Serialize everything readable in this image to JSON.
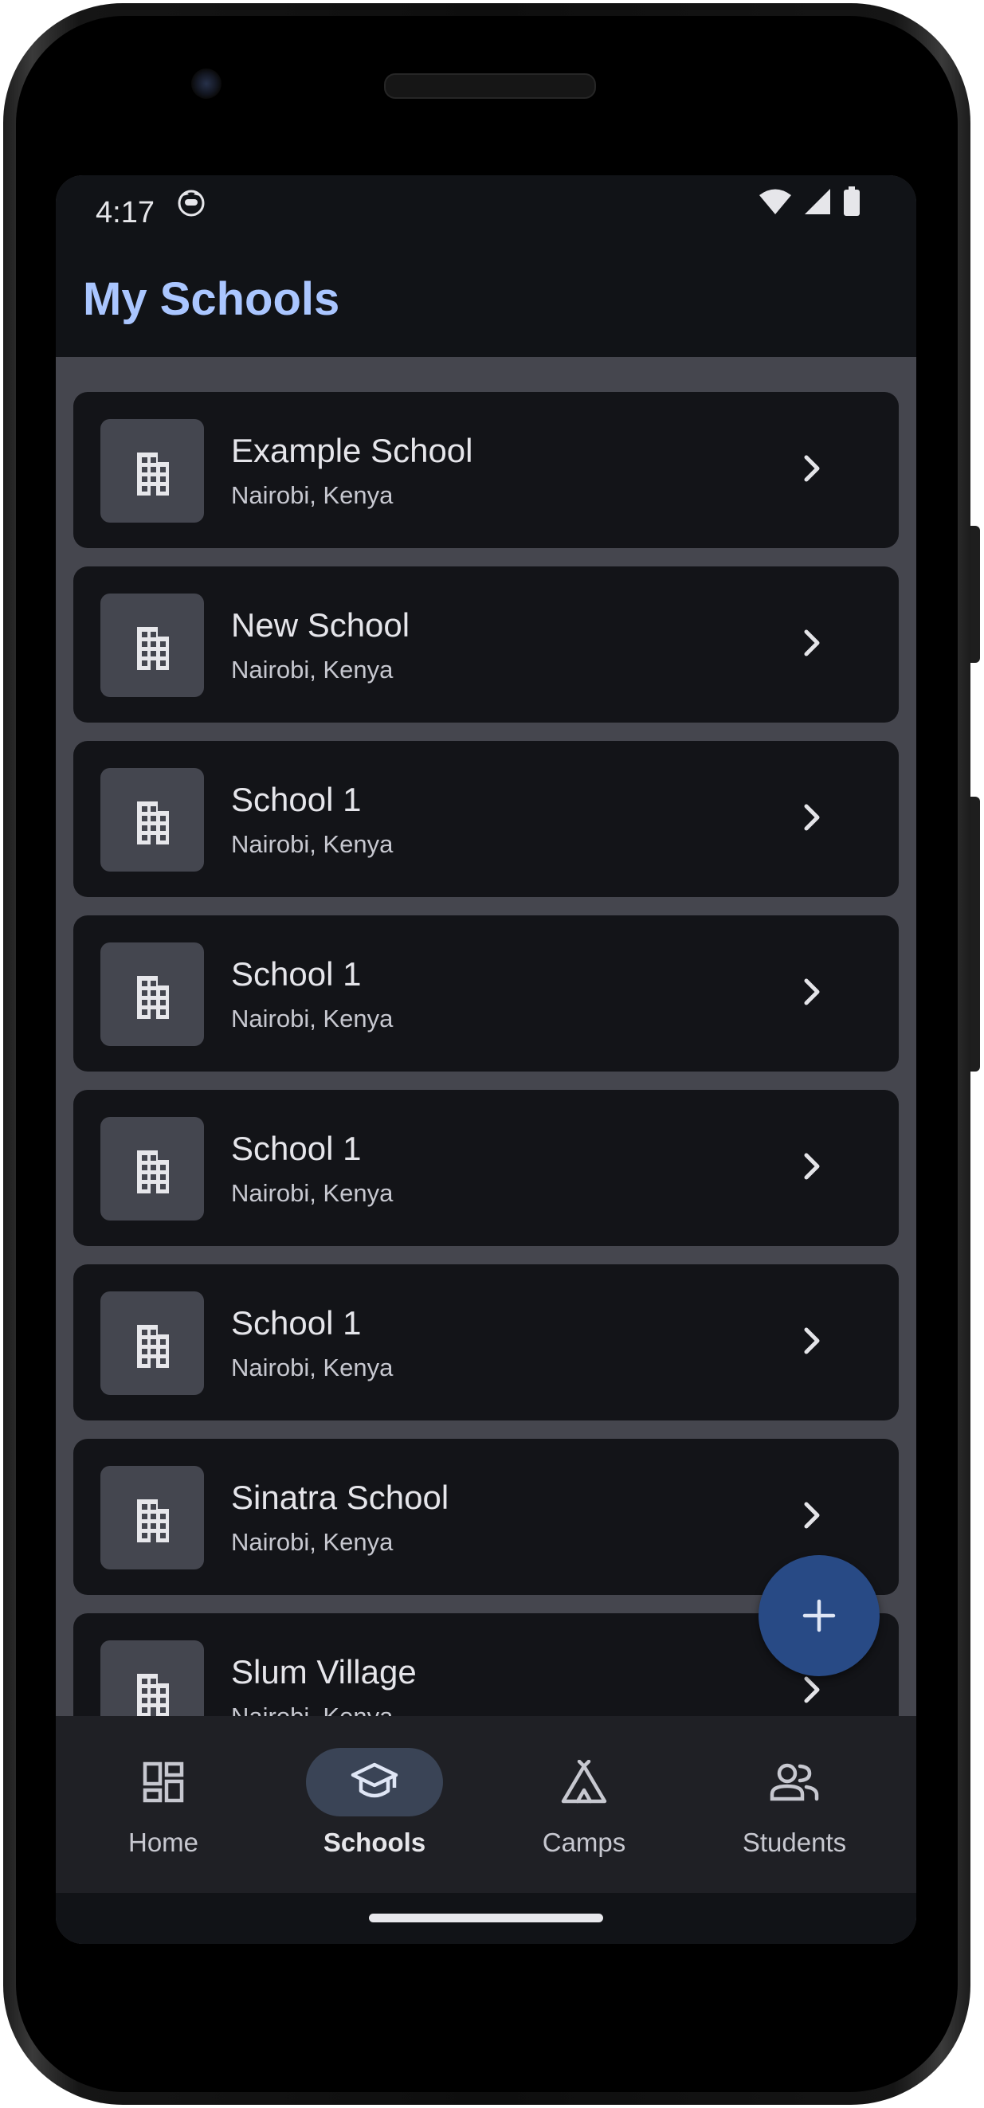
{
  "status_bar": {
    "time": "4:17",
    "icons": [
      "face-icon",
      "wifi-icon",
      "signal-icon",
      "battery-icon"
    ]
  },
  "app_bar": {
    "title": "My Schools"
  },
  "schools": [
    {
      "name": "Example School",
      "location": "Nairobi, Kenya"
    },
    {
      "name": "New School",
      "location": "Nairobi, Kenya"
    },
    {
      "name": "School 1",
      "location": "Nairobi, Kenya"
    },
    {
      "name": "School 1",
      "location": "Nairobi, Kenya"
    },
    {
      "name": "School 1",
      "location": "Nairobi, Kenya"
    },
    {
      "name": "School 1",
      "location": "Nairobi, Kenya"
    },
    {
      "name": "Sinatra School",
      "location": "Nairobi, Kenya"
    },
    {
      "name": "Slum Village",
      "location": "Nairobi, Kenya"
    }
  ],
  "fab": {
    "icon": "plus-icon"
  },
  "bottom_nav": {
    "items": [
      {
        "label": "Home",
        "icon": "dashboard-icon",
        "active": false
      },
      {
        "label": "Schools",
        "icon": "school-icon",
        "active": true
      },
      {
        "label": "Camps",
        "icon": "tent-icon",
        "active": false
      },
      {
        "label": "Students",
        "icon": "people-icon",
        "active": false
      }
    ]
  },
  "colors": {
    "title": "#aac6ff",
    "surface": "#131418",
    "list_background": "#45464e",
    "fab": "#284a85",
    "nav_active_pill": "#3a4456"
  }
}
